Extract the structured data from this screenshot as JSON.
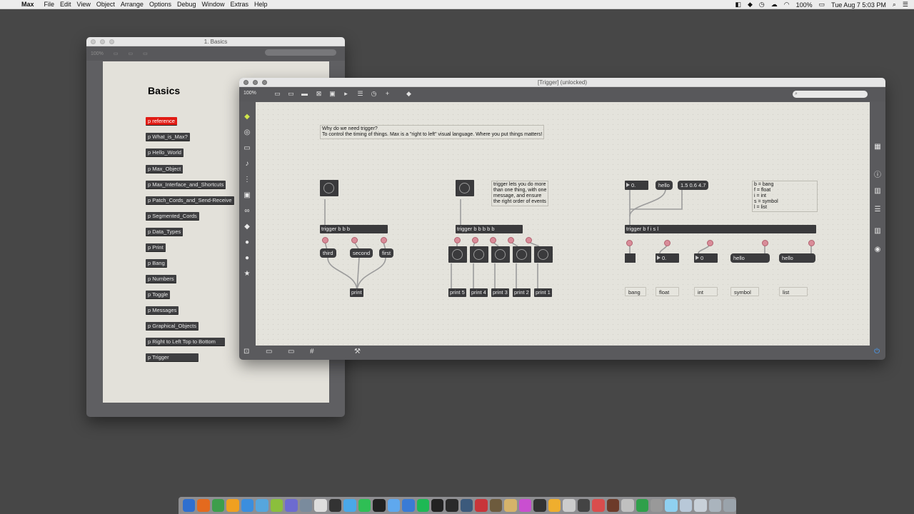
{
  "menubar": {
    "app": "Max",
    "items": [
      "File",
      "Edit",
      "View",
      "Object",
      "Arrange",
      "Options",
      "Debug",
      "Window",
      "Extras",
      "Help"
    ],
    "battery": "100%",
    "clock": "Tue Aug 7  5:03 PM"
  },
  "basics_window": {
    "title": "1. Basics",
    "zoom": "100%",
    "heading": "Basics",
    "subpatchers": [
      "p reference",
      "p What_is_Max?",
      "p Hello_World",
      "p Max_Object",
      "p Max_Interface_and_Shortcuts",
      "p Patch_Cords_and_Send-Receive",
      "p Segmented_Cords",
      "p Data_Types",
      "p Print",
      "p Bang",
      "p Numbers",
      "p Toggle",
      "p Messages",
      "p Graphical_Objects",
      "p Right to Left Top to Bottom",
      "p Trigger"
    ]
  },
  "trigger_window": {
    "title": "[Trigger] (unlocked)",
    "zoom": "100%",
    "intro_comment": [
      "Why do we need trigger?",
      "To control the timing of things. Max is a \"right to left\" visual language. Where you put things matters!"
    ],
    "section1": {
      "trigger": "trigger b b b",
      "messages": [
        "third",
        "second",
        "first"
      ],
      "print": "print"
    },
    "section2": {
      "trigger": "trigger b b b b b",
      "comment": [
        "trigger lets you do more",
        "than one thing, with one",
        "message, and ensure",
        "the right order of events"
      ],
      "prints": [
        "print 5",
        "print 4",
        "print 3",
        "print 2",
        "print 1"
      ]
    },
    "section3": {
      "float_in": "0.",
      "msg_hello": "hello",
      "msg_list": "1.5 0.6 4.7",
      "legend": [
        "b = bang",
        "f = float",
        "i = int",
        "s = symbol",
        "l = list"
      ],
      "trigger": "trigger b f i s l",
      "float_out": "0.",
      "int_out": "0",
      "symbol_out": "hello",
      "list_out": "hello",
      "labels": [
        "bang",
        "float",
        "int",
        "symbol",
        "list"
      ]
    }
  }
}
